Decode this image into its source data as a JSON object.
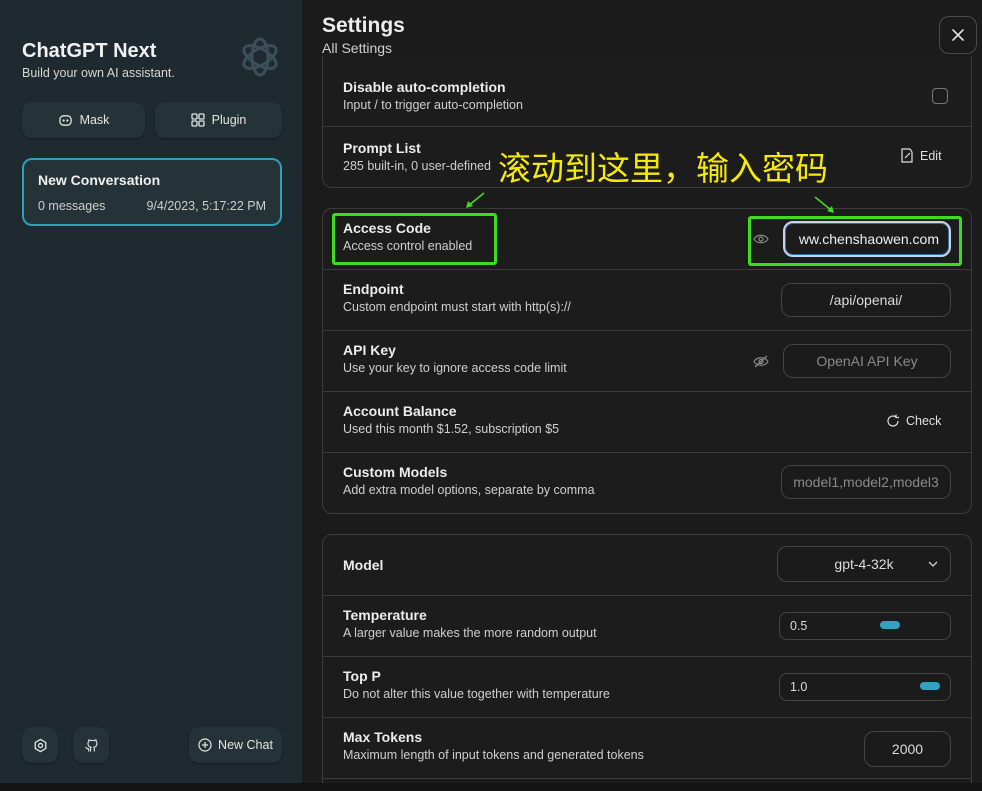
{
  "sidebar": {
    "title": "ChatGPT Next",
    "subtitle": "Build your own AI assistant.",
    "logo_icon": "openai-logo",
    "buttons": [
      {
        "label": "Mask",
        "icon": "mask-icon"
      },
      {
        "label": "Plugin",
        "icon": "plugin-grid-icon"
      }
    ],
    "conversations": [
      {
        "title": "New Conversation",
        "messages": "0 messages",
        "time": "9/4/2023, 5:17:22 PM"
      }
    ],
    "footer": {
      "settings_icon": "gear-icon",
      "github_icon": "github-icon",
      "new_chat_label": "New Chat"
    }
  },
  "header": {
    "title": "Settings",
    "subtitle": "All Settings",
    "close_icon": "close-icon"
  },
  "settings_top": [
    {
      "title": "Disable auto-completion",
      "subtitle": "Input / to trigger auto-completion",
      "control": "checkbox",
      "checked": false
    },
    {
      "title": "Prompt List",
      "subtitle": "285 built-in, 0 user-defined",
      "control": "button",
      "button_label": "Edit"
    }
  ],
  "settings_access": {
    "access_code": {
      "title": "Access Code",
      "subtitle": "Access control enabled",
      "value": "www.chenshaowen.com",
      "shown_value": "ww.chenshaowen.com"
    },
    "endpoint": {
      "title": "Endpoint",
      "subtitle": "Custom endpoint must start with http(s)://",
      "value": "/api/openai/"
    },
    "api_key": {
      "title": "API Key",
      "subtitle": "Use your key to ignore access code limit",
      "placeholder": "OpenAI API Key"
    },
    "balance": {
      "title": "Account Balance",
      "subtitle": "Used this month $1.52, subscription $5",
      "button_label": "Check"
    },
    "custom_models": {
      "title": "Custom Models",
      "subtitle": "Add extra model options, separate by comma",
      "placeholder": "model1,model2,model3"
    }
  },
  "settings_model": {
    "model": {
      "title": "Model",
      "value": "gpt-4-32k"
    },
    "temperature": {
      "title": "Temperature",
      "subtitle": "A larger value makes the more random output",
      "value": "0.5",
      "fraction": 0.5
    },
    "top_p": {
      "title": "Top P",
      "subtitle": "Do not alter this value together with temperature",
      "value": "1.0",
      "fraction": 1.0
    },
    "max_tokens": {
      "title": "Max Tokens",
      "subtitle": "Maximum length of input tokens and generated tokens",
      "value": "2000"
    }
  },
  "annotation": {
    "text": "滚动到这里，输入密码",
    "color": "#f5e90b",
    "highlight_color": "#3edc1f"
  },
  "colors": {
    "accent": "#2ea0b8",
    "sidebar_bg": "#1e2a30",
    "main_bg": "#1b1b1b"
  }
}
